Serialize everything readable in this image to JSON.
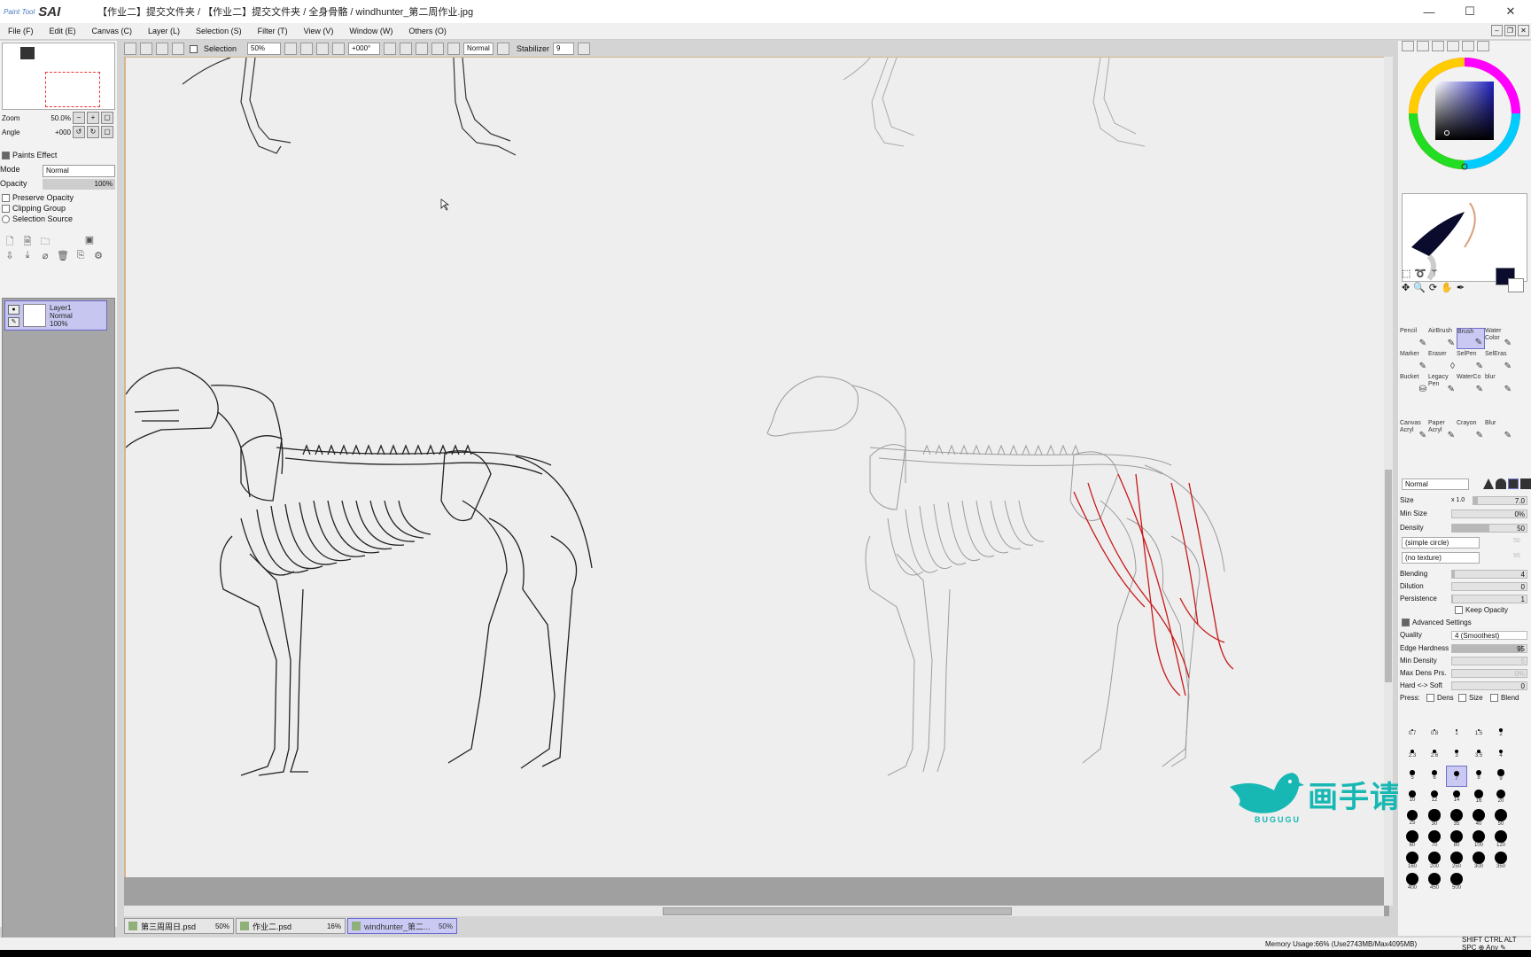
{
  "app": {
    "logo_small": "Paint Tool",
    "logo_big": "SAI"
  },
  "window": {
    "title": "【作业二】提交文件夹 / 【作业二】提交文件夹 / 全身骨骼 / windhunter_第二周作业.jpg",
    "min": "—",
    "max": "☐",
    "close": "✕"
  },
  "menu": [
    "File (F)",
    "Edit (E)",
    "Canvas (C)",
    "Layer (L)",
    "Selection (S)",
    "Filter (T)",
    "View (V)",
    "Window (W)",
    "Others (O)"
  ],
  "left_panel": {
    "zoom_label": "Zoom",
    "zoom_value": "50.0%",
    "angle_label": "Angle",
    "angle_value": "+000",
    "paints_effect": "Paints Effect",
    "mode_label": "Mode",
    "mode_value": "Normal",
    "opacity_label": "Opacity",
    "opacity_value": "100%",
    "preserve_opacity": "Preserve Opacity",
    "clipping_group": "Clipping Group",
    "selection_source": "Selection Source",
    "layer": {
      "name": "Layer1",
      "mode": "Normal",
      "opacity": "100%"
    }
  },
  "toolbar": {
    "selection_label": "Selection",
    "zoom": "50%",
    "angle": "+000°",
    "blend": "Normal",
    "stabilizer_label": "Stabilizer",
    "stabilizer_value": "9"
  },
  "tabs": [
    {
      "name": "第三周周日.psd",
      "zoom": "50%"
    },
    {
      "name": "作业二.psd",
      "zoom": "16%"
    },
    {
      "name": "windhunter_第二...",
      "zoom": "50%"
    }
  ],
  "status": {
    "memory": "Memory Usage:66% (Use2743MB/Max4095MB)",
    "keys": "SHIFT CTRL ALT SPC ⊕ Any ✎"
  },
  "watermark": {
    "text": "画手请就位",
    "sub": "BUGUGU"
  },
  "right_panel": {
    "tools": [
      [
        "Pencil",
        "AirBrush",
        "Brush",
        "Water Color"
      ],
      [
        "Marker",
        "Eraser",
        "SelPen",
        "SelEras"
      ],
      [
        "Bucket",
        "Legacy Pen",
        "WaterCo",
        "blur"
      ],
      [
        "Canvas Acryl",
        "Paper Acryl",
        "Crayon",
        "Blur"
      ]
    ],
    "blend_mode": "Normal",
    "size_label": "Size",
    "size_mult": "x 1.0",
    "size_value": "7.0",
    "min_size_label": "Min Size",
    "min_size_value": "0%",
    "density_label": "Density",
    "density_value": "50",
    "shape": "(simple circle)",
    "shape_value": "50",
    "texture": "(no texture)",
    "texture_value": "95",
    "blending_label": "Blending",
    "blending_value": "4",
    "dilution_label": "Dilution",
    "dilution_value": "0",
    "persistence_label": "Persistence",
    "persistence_value": "1",
    "keep_opacity": "Keep Opacity",
    "advanced": "Advanced Settings",
    "quality_label": "Quality",
    "quality_value": "4 (Smoothest)",
    "edge_label": "Edge Hardness",
    "edge_value": "95",
    "min_density_label": "Min Density",
    "min_density_value": "5",
    "max_dens_label": "Max Dens Prs.",
    "max_dens_value": "0%",
    "hard_soft_label": "Hard <-> Soft",
    "hard_soft_value": "0",
    "press_label": "Press:",
    "press_dens": "Dens",
    "press_size": "Size",
    "press_blend": "Blend",
    "sizes": [
      "0.7",
      "0.8",
      "1",
      "1.5",
      "2",
      "2.3",
      "2.6",
      "3",
      "3.5",
      "4",
      "5",
      "6",
      "7",
      "8",
      "9",
      "10",
      "12",
      "14",
      "16",
      "20",
      "25",
      "30",
      "35",
      "40",
      "50",
      "60",
      "70",
      "80",
      "100",
      "120",
      "160",
      "200",
      "250",
      "300",
      "350",
      "400",
      "450",
      "500"
    ]
  }
}
